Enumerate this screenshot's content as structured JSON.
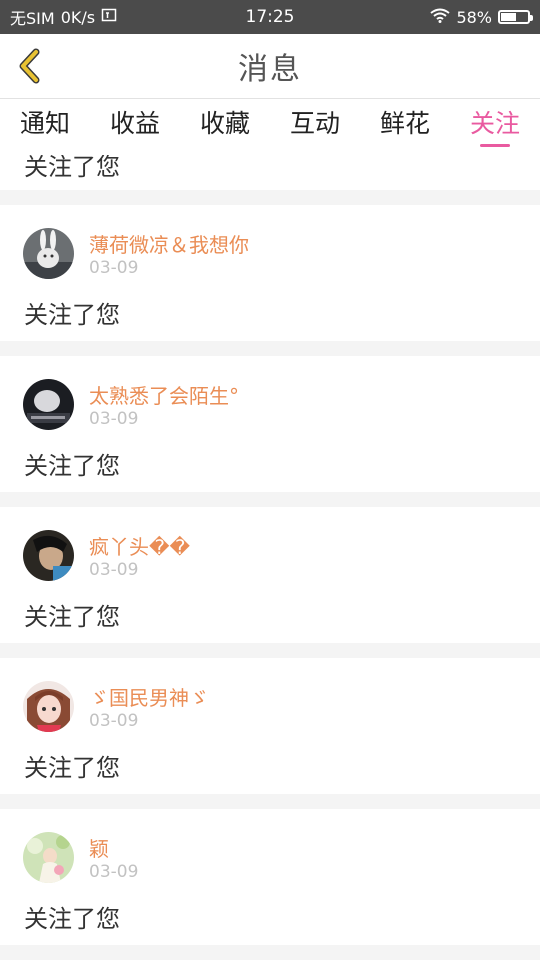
{
  "status_bar": {
    "carrier": "无SIM",
    "speed": "0K/s",
    "time": "17:25",
    "battery_percent": "58%",
    "battery_level": 0.58
  },
  "nav": {
    "title": "消息"
  },
  "tabs": [
    {
      "label": "通知",
      "active": false
    },
    {
      "label": "收益",
      "active": false
    },
    {
      "label": "收藏",
      "active": false
    },
    {
      "label": "互动",
      "active": false
    },
    {
      "label": "鲜花",
      "active": false
    },
    {
      "label": "关注",
      "active": true
    }
  ],
  "feed": {
    "partial_item": {
      "message": "关注了您"
    },
    "items": [
      {
        "name": "薄荷微凉＆我想你",
        "date": "03-09",
        "message": "关注了您"
      },
      {
        "name": "太熟悉了会陌生°",
        "date": "03-09",
        "message": "关注了您"
      },
      {
        "name": "疯丫头��",
        "date": "03-09",
        "message": "关注了您"
      },
      {
        "name": "ゞ国民男神ゞ",
        "date": "03-09",
        "message": "关注了您"
      },
      {
        "name": "颖",
        "date": "03-09",
        "message": "关注了您"
      }
    ]
  },
  "colors": {
    "accent": "#e95aa0",
    "name": "#ea8d55",
    "back_arrow": "#e8c233"
  }
}
